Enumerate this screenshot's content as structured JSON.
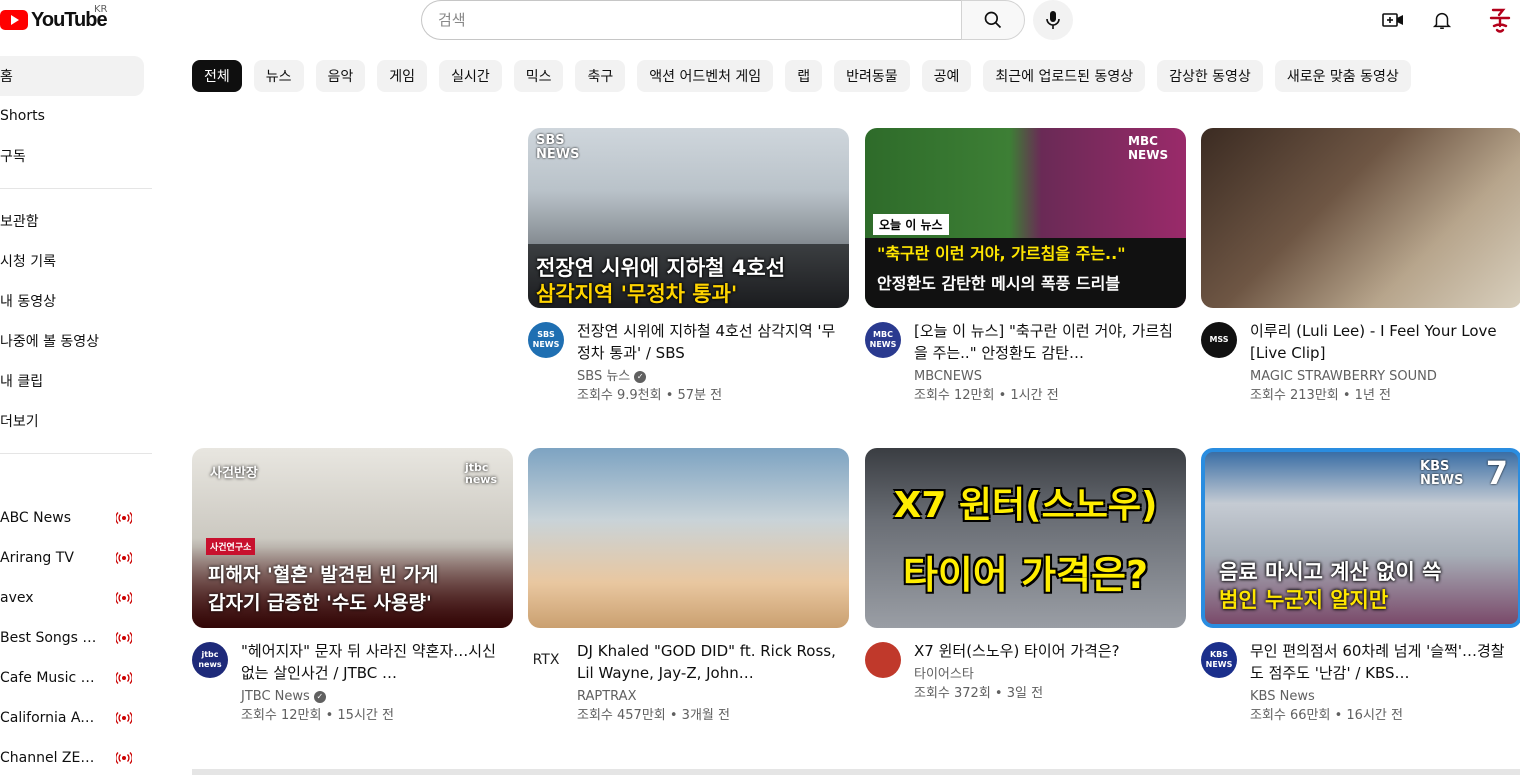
{
  "header": {
    "logo_text": "YouTube",
    "region": "KR",
    "search_placeholder": "검색"
  },
  "sidebar": {
    "primary": [
      {
        "label": "홈",
        "active": true
      },
      {
        "label": "Shorts"
      },
      {
        "label": "구독"
      }
    ],
    "library": [
      {
        "label": "보관함"
      },
      {
        "label": "시청 기록"
      },
      {
        "label": "내 동영상"
      },
      {
        "label": "나중에 볼 동영상"
      },
      {
        "label": "내 클립"
      },
      {
        "label": "더보기"
      }
    ],
    "subscriptions": [
      {
        "label": "ABC News"
      },
      {
        "label": "Arirang TV"
      },
      {
        "label": "avex"
      },
      {
        "label": "Best Songs Co…"
      },
      {
        "label": "Cafe Music BG…"
      },
      {
        "label": "California Acad…"
      },
      {
        "label": "Channel ZERO"
      }
    ]
  },
  "chips": [
    "전체",
    "뉴스",
    "음악",
    "게임",
    "실시간",
    "믹스",
    "축구",
    "액션 어드벤처 게임",
    "랩",
    "반려동물",
    "공예",
    "최근에 업로드된 동영상",
    "감상한 동영상",
    "새로운 맞춤 동영상"
  ],
  "videos": [
    {
      "title": "전장연 시위에 지하철 4호선 삼각지역 '무정차 통과' / SBS",
      "channel": "SBS 뉴스",
      "verified": true,
      "stats": "조회수 9.9천회 • 57분 전",
      "avatar_text": "SBS NEWS",
      "avatar_color": "#1f6fb2",
      "thumb_logo": "SBS NEWS",
      "thumb_line1": "전장연 시위에 지하철 4호선",
      "thumb_line2": "삼각지역 '무정차 통과'"
    },
    {
      "title": "[오늘 이 뉴스] \"축구란 이런 거야, 가르침을 주는..\" 안정환도 감탄…",
      "channel": "MBCNEWS",
      "verified": false,
      "stats": "조회수 12만회 • 1시간 전",
      "avatar_text": "MBC NEWS",
      "avatar_color": "#2a3a8f",
      "thumb_logo": "MBC NEWS",
      "thumb_tag": "오늘 이 뉴스",
      "thumb_line1": "\"축구란 이런 거야, 가르침을 주는..\"",
      "thumb_line2": "안정환도 감탄한 메시의 폭풍 드리블"
    },
    {
      "title": "이루리 (Luli Lee) - I Feel Your Love [Live Clip]",
      "channel": "MAGIC STRAWBERRY SOUND",
      "verified": false,
      "stats": "조회수 213만회 • 1년 전",
      "avatar_text": "MSS",
      "avatar_color": "#111111"
    },
    {
      "title": "\"헤어지자\" 문자 뒤 사라진 약혼자…시신 없는 살인사건 / JTBC …",
      "channel": "JTBC News",
      "verified": true,
      "stats": "조회수 12만회 • 15시간 전",
      "avatar_text": "jtbc news",
      "avatar_color": "#1e2a7a",
      "thumb_logo": "jtbc news",
      "thumb_corner": "사건반장",
      "thumb_tag": "사건연구소",
      "thumb_line1": "피해자 '혈흔' 발견된 빈 가게",
      "thumb_line2": "갑자기 급증한 '수도 사용량'"
    },
    {
      "title": "DJ Khaled \"GOD DID\" ft. Rick Ross, Lil Wayne, Jay-Z, John…",
      "channel": "RAPTRAX",
      "verified": false,
      "stats": "조회수 457만회 • 3개월 전",
      "avatar_text": "RTX",
      "avatar_color": "#ffffff"
    },
    {
      "title": "X7 윈터(스노우) 타이어 가격은?",
      "channel": "타이어스타",
      "verified": false,
      "stats": "조회수 372회 • 3일 전",
      "avatar_text": "",
      "avatar_color": "#c0392b",
      "thumb_line1": "X7 윈터(스노우)",
      "thumb_line2": "타이어 가격은?"
    },
    {
      "title": "무인 편의점서 60차례 넘게 '슬쩍'…경찰도 점주도 '난감' / KBS…",
      "channel": "KBS News",
      "verified": false,
      "stats": "조회수 66만회 • 16시간 전",
      "avatar_text": "KBS NEWS",
      "avatar_color": "#1b2f8c",
      "thumb_logo": "KBS NEWS",
      "thumb_num": "7",
      "thumb_line1": "음료 마시고 계산 없이 쓱",
      "thumb_line2": "범인 누군지 알지만"
    }
  ]
}
